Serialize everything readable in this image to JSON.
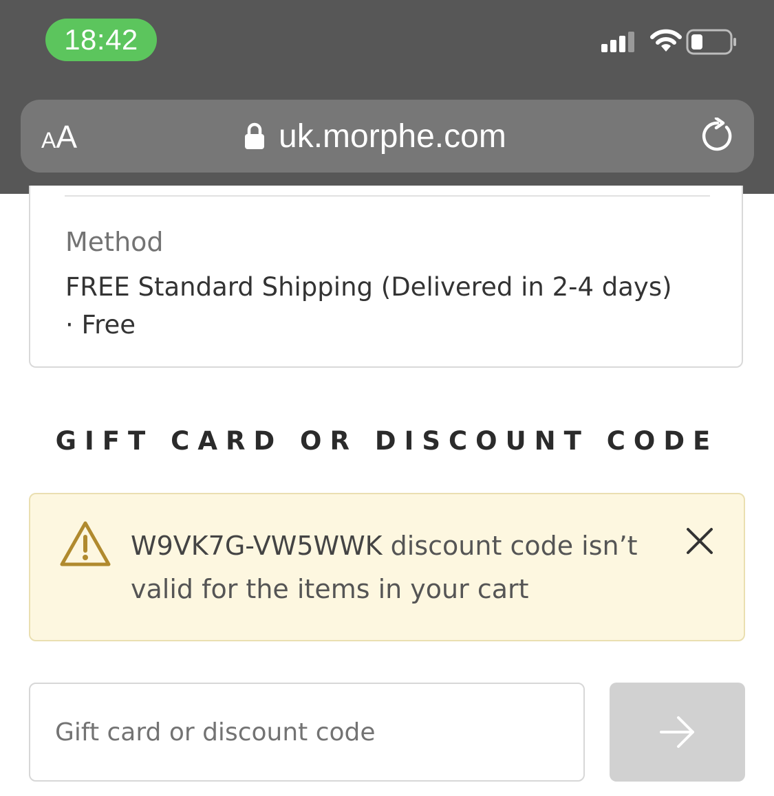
{
  "status_bar": {
    "time": "18:42",
    "signal_icon": "signal-bars-icon",
    "wifi_icon": "wifi-icon",
    "battery_icon": "battery-low-icon",
    "time_pill_color": "#5cc55d"
  },
  "browser": {
    "text_size_small": "A",
    "text_size_large": "A",
    "url": "uk.morphe.com",
    "lock_icon": "lock-icon",
    "reload_icon": "reload-icon"
  },
  "shipping": {
    "label": "Method",
    "method": "FREE Standard Shipping (Delivered in 2-4 days)",
    "separator": " · ",
    "price": "Free"
  },
  "discount": {
    "heading": "GIFT CARD OR DISCOUNT CODE",
    "alert": {
      "icon": "warning-triangle-icon",
      "code": "W9VK7G-VW5WWK",
      "message": " discount code isn’t valid for the items in your cart",
      "close_icon": "close-icon",
      "background": "#fdf7e0",
      "icon_color": "#b08a2e"
    },
    "input": {
      "placeholder": "Gift card or discount code",
      "value": ""
    },
    "apply_icon": "arrow-right-icon"
  }
}
